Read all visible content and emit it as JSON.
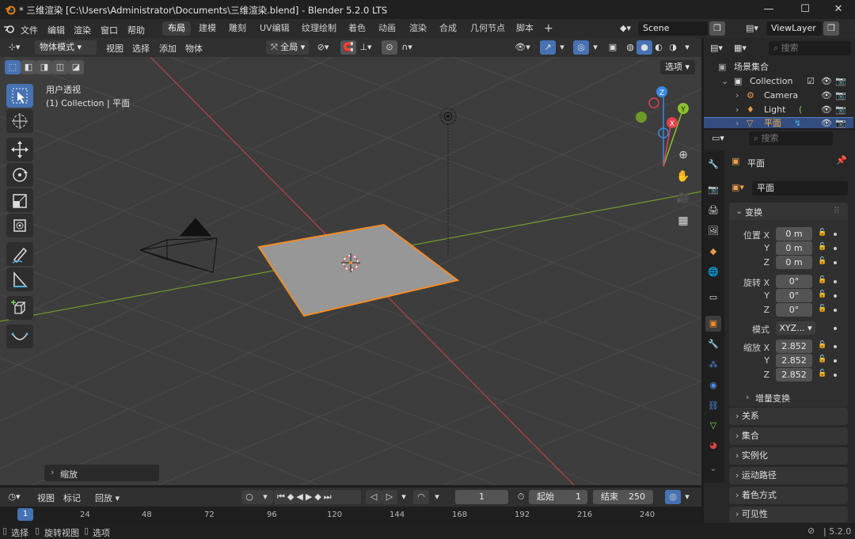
{
  "window": {
    "title": "* 三维渲染 [C:\\Users\\Administrator\\Documents\\三维渲染.blend] - Blender 5.2.0 LTS",
    "minimize": "—",
    "maximize": "☐",
    "close": "✕"
  },
  "menu": {
    "items": [
      "文件",
      "编辑",
      "渲染",
      "窗口",
      "帮助"
    ],
    "workspaces": [
      "布局",
      "建模",
      "雕刻",
      "UV编辑",
      "纹理绘制",
      "着色",
      "动画",
      "渲染",
      "合成",
      "几何节点",
      "脚本"
    ],
    "active_workspace": "布局",
    "add_workspace": "+",
    "scene": "Scene",
    "view_layer": "ViewLayer"
  },
  "viewport_header": {
    "mode": "物体模式",
    "menus": [
      "视图",
      "选择",
      "添加",
      "物体"
    ],
    "orientation": "全局",
    "options": "选项"
  },
  "viewport": {
    "view_name": "用户透视",
    "context": "(1) Collection | 平面",
    "last_operator": "缩放",
    "gizmo": {
      "z": "Z",
      "y": "Y",
      "x": "X"
    }
  },
  "outliner": {
    "search_placeholder": "搜索",
    "root": "场景集合",
    "items": [
      {
        "name": "Collection",
        "icon": "collection-icon"
      },
      {
        "name": "Camera",
        "icon": "camera-object-icon"
      },
      {
        "name": "Light",
        "icon": "light-object-icon"
      },
      {
        "name": "平面",
        "icon": "mesh-object-icon"
      }
    ]
  },
  "properties": {
    "search_placeholder": "搜索",
    "object_name": "平面",
    "datablock_name": "平面",
    "transform_title": "变换",
    "location_label": "位置 X",
    "rotation_label": "旋转 X",
    "mode_label": "模式",
    "scale_label": "缩放 X",
    "y_label": "Y",
    "z_label": "Z",
    "location": [
      "0 m",
      "0 m",
      "0 m"
    ],
    "rotation": [
      "0°",
      "0°",
      "0°"
    ],
    "rotation_mode": "XYZ...",
    "scale": [
      "2.852",
      "2.852",
      "2.852"
    ],
    "delta_transform": "增量变换",
    "panels": [
      "关系",
      "集合",
      "实例化",
      "运动路径",
      "着色方式",
      "可见性"
    ]
  },
  "timeline": {
    "menus": [
      "视图",
      "标记",
      "回放"
    ],
    "current_frame": "1",
    "start_label": "起始",
    "start": "1",
    "end_label": "结束",
    "end": "250",
    "playhead": "1",
    "ticks": [
      "24",
      "48",
      "72",
      "96",
      "120",
      "144",
      "168",
      "192",
      "216",
      "240"
    ]
  },
  "statusbar": {
    "select": "选择",
    "rotate_view": "旋转视图",
    "select_item": "选项",
    "version": "5.2.0"
  },
  "colors": {
    "selection_orange": "#f08c28",
    "active_blue": "#4772b3",
    "x_axis": "#b84244",
    "y_axis": "#6f9b2c",
    "gizmo_x": "#e5404f",
    "gizmo_y": "#8bc12b",
    "gizmo_z": "#3b87e3"
  }
}
